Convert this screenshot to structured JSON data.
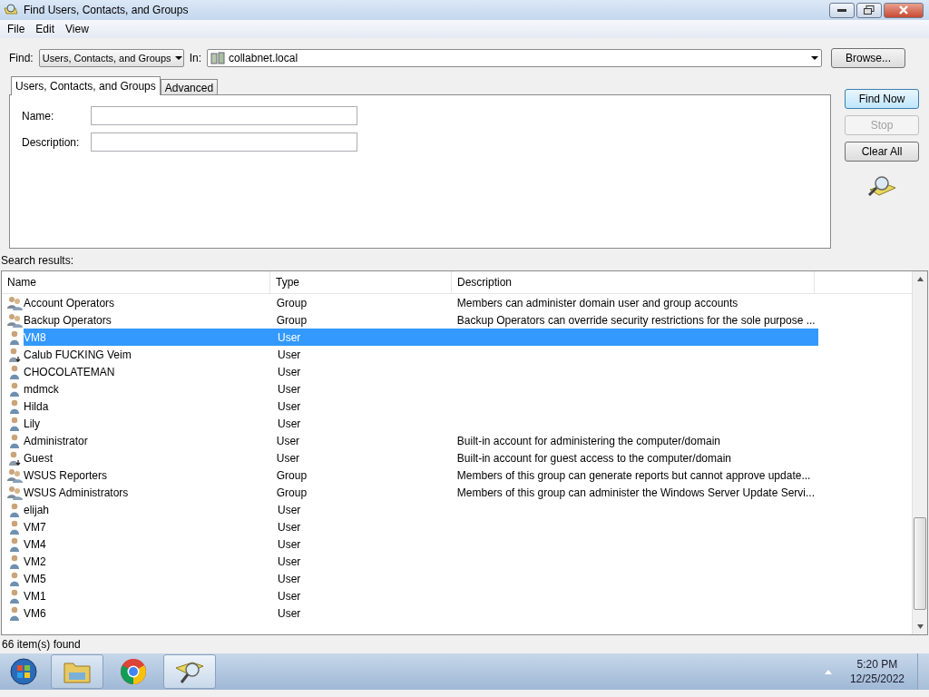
{
  "window": {
    "title": "Find Users, Contacts, and Groups"
  },
  "menu": [
    "File",
    "Edit",
    "View"
  ],
  "find": {
    "label": "Find:",
    "value": "Users, Contacts, and Groups",
    "in_label": "In:",
    "in_value": "collabnet.local",
    "browse": "Browse..."
  },
  "tabs": [
    {
      "label": "Users, Contacts, and Groups",
      "selected": true
    },
    {
      "label": "Advanced",
      "selected": false
    }
  ],
  "fields": [
    {
      "label": "Name:"
    },
    {
      "label": "Description:"
    }
  ],
  "buttons": [
    {
      "label": "Find Now",
      "disabled": false,
      "default": true
    },
    {
      "label": "Stop",
      "disabled": true,
      "default": false
    },
    {
      "label": "Clear All",
      "disabled": false,
      "default": false
    }
  ],
  "results_label": "Search results:",
  "table": {
    "columns": [
      "Name",
      "Type",
      "Description"
    ],
    "rows": [
      {
        "kind": "group",
        "name": "Account Operators",
        "type": "Group",
        "description": "Members can administer domain user and group accounts",
        "selected": false
      },
      {
        "kind": "group",
        "name": "Backup Operators",
        "type": "Group",
        "description": "Backup Operators can override security restrictions for the sole purpose ...",
        "selected": false
      },
      {
        "kind": "user",
        "name": "VM8",
        "type": "User",
        "selected": true
      },
      {
        "kind": "disabled-user",
        "name": "Calub FUCKING Veim",
        "type": "User",
        "selected": false
      },
      {
        "kind": "user",
        "name": "CHOCOLATEMAN",
        "type": "User",
        "selected": false
      },
      {
        "kind": "user",
        "name": "mdmck",
        "type": "User",
        "selected": false
      },
      {
        "kind": "user",
        "name": "Hilda",
        "type": "User",
        "selected": false
      },
      {
        "kind": "user",
        "name": "Lily",
        "type": "User",
        "selected": false
      },
      {
        "kind": "user",
        "name": "Administrator",
        "type": "User",
        "description": "Built-in account for administering the computer/domain",
        "selected": false
      },
      {
        "kind": "disabled-user",
        "name": "Guest",
        "type": "User",
        "description": "Built-in account for guest access to the computer/domain",
        "selected": false
      },
      {
        "kind": "group",
        "name": "WSUS Reporters",
        "type": "Group",
        "description": "Members of this group can generate reports but cannot approve update...",
        "selected": false
      },
      {
        "kind": "group",
        "name": "WSUS Administrators",
        "type": "Group",
        "description": "Members of this group can administer the Windows Server Update Servi...",
        "selected": false
      },
      {
        "kind": "user",
        "name": "elijah",
        "type": "User",
        "selected": false
      },
      {
        "kind": "user",
        "name": "VM7",
        "type": "User",
        "selected": false
      },
      {
        "kind": "user",
        "name": "VM4",
        "type": "User",
        "selected": false
      },
      {
        "kind": "user",
        "name": "VM2",
        "type": "User",
        "selected": false
      },
      {
        "kind": "user",
        "name": "VM5",
        "type": "User",
        "selected": false
      },
      {
        "kind": "user",
        "name": "VM1",
        "type": "User",
        "selected": false
      },
      {
        "kind": "user",
        "name": "VM6",
        "type": "User",
        "selected": false
      }
    ]
  },
  "status_bar": "66 item(s) found",
  "taskbar": {
    "time": "5:20 PM",
    "date": "12/25/2022"
  }
}
